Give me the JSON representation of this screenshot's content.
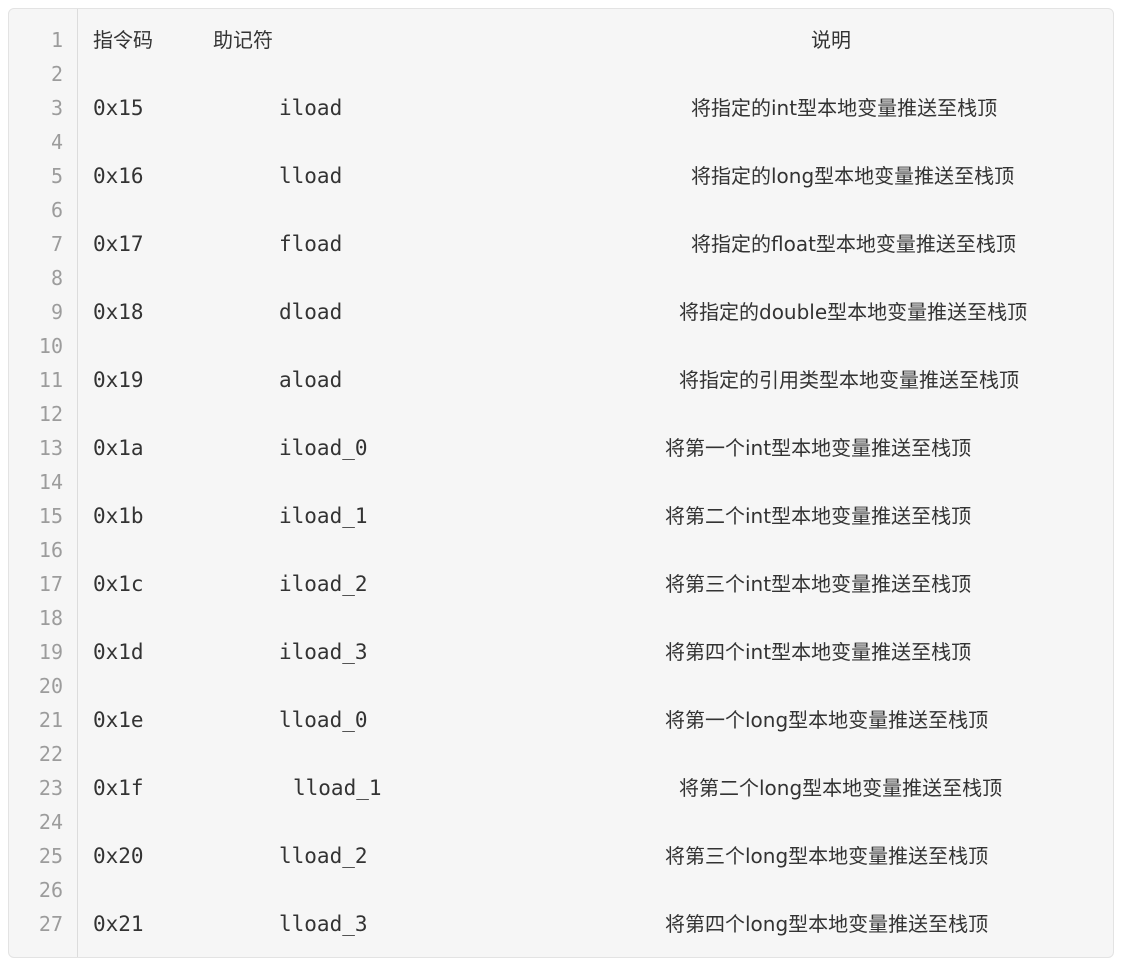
{
  "code_block": {
    "lines": [
      {
        "n": "1",
        "op": "指令码",
        "mn": "助记符",
        "desc": "说明"
      },
      {
        "n": "2",
        "op": "",
        "mn": "",
        "desc": ""
      },
      {
        "n": "3",
        "op": "0x15",
        "mn": "iload",
        "desc": "将指定的int型本地变量推送至栈顶"
      },
      {
        "n": "4",
        "op": "",
        "mn": "",
        "desc": ""
      },
      {
        "n": "5",
        "op": "0x16",
        "mn": "lload",
        "desc": "将指定的long型本地变量推送至栈顶"
      },
      {
        "n": "6",
        "op": "",
        "mn": "",
        "desc": ""
      },
      {
        "n": "7",
        "op": "0x17",
        "mn": "fload",
        "desc": "将指定的float型本地变量推送至栈顶"
      },
      {
        "n": "8",
        "op": "",
        "mn": "",
        "desc": ""
      },
      {
        "n": "9",
        "op": "0x18",
        "mn": "dload",
        "desc": "将指定的double型本地变量推送至栈顶"
      },
      {
        "n": "10",
        "op": "",
        "mn": "",
        "desc": ""
      },
      {
        "n": "11",
        "op": "0x19",
        "mn": "aload",
        "desc": "将指定的引用类型本地变量推送至栈顶"
      },
      {
        "n": "12",
        "op": "",
        "mn": "",
        "desc": ""
      },
      {
        "n": "13",
        "op": "0x1a",
        "mn": "iload_0",
        "desc": "将第一个int型本地变量推送至栈顶"
      },
      {
        "n": "14",
        "op": "",
        "mn": "",
        "desc": ""
      },
      {
        "n": "15",
        "op": "0x1b",
        "mn": "iload_1",
        "desc": "将第二个int型本地变量推送至栈顶"
      },
      {
        "n": "16",
        "op": "",
        "mn": "",
        "desc": ""
      },
      {
        "n": "17",
        "op": "0x1c",
        "mn": "iload_2",
        "desc": "将第三个int型本地变量推送至栈顶"
      },
      {
        "n": "18",
        "op": "",
        "mn": "",
        "desc": ""
      },
      {
        "n": "19",
        "op": "0x1d",
        "mn": "iload_3",
        "desc": "将第四个int型本地变量推送至栈顶"
      },
      {
        "n": "20",
        "op": "",
        "mn": "",
        "desc": ""
      },
      {
        "n": "21",
        "op": "0x1e",
        "mn": "lload_0",
        "desc": "将第一个long型本地变量推送至栈顶"
      },
      {
        "n": "22",
        "op": "",
        "mn": "",
        "desc": ""
      },
      {
        "n": "23",
        "op": "0x1f",
        "mn": "lload_1",
        "desc": "将第二个long型本地变量推送至栈顶"
      },
      {
        "n": "24",
        "op": "",
        "mn": "",
        "desc": ""
      },
      {
        "n": "25",
        "op": "0x20",
        "mn": "lload_2",
        "desc": "将第三个long型本地变量推送至栈顶"
      },
      {
        "n": "26",
        "op": "",
        "mn": "",
        "desc": ""
      },
      {
        "n": "27",
        "op": "0x21",
        "mn": "lload_3",
        "desc": "将第四个long型本地变量推送至栈顶"
      }
    ]
  }
}
